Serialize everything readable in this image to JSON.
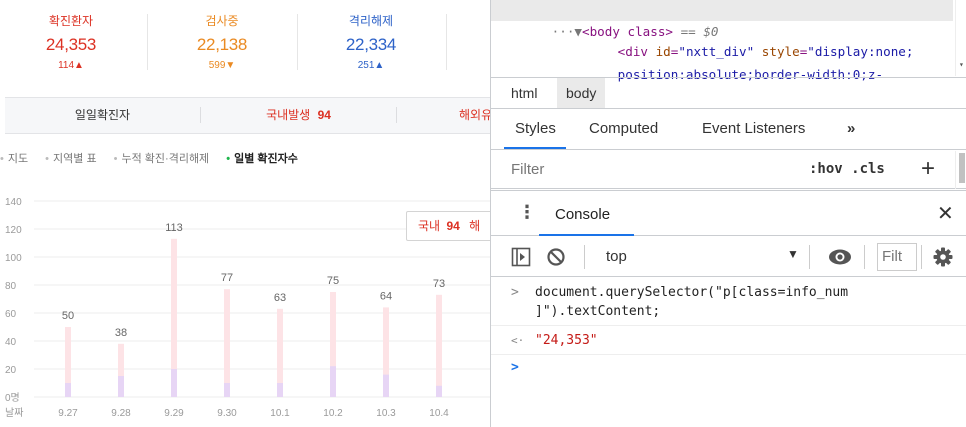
{
  "page": {
    "stats": [
      {
        "label": "확진환자",
        "value": "24,353",
        "change": "114▲",
        "color": "#dc3123"
      },
      {
        "label": "검사중",
        "value": "22,138",
        "change": "599▼",
        "color": "#ea8a22"
      },
      {
        "label": "격리해제",
        "value": "22,334",
        "change": "251▲",
        "color": "#2d62c8"
      }
    ],
    "tabs": [
      {
        "label": "일일확진자",
        "count": ""
      },
      {
        "label": "국내발생",
        "count": "94"
      },
      {
        "label": "해외유",
        "count": ""
      }
    ],
    "subnav": [
      "지도",
      "지역별 표",
      "누적 확진·격리해제",
      "일별 확진자수"
    ],
    "tooltip": {
      "label": "국내",
      "value": "94",
      "extra": "해"
    }
  },
  "chart_data": {
    "type": "bar",
    "categories": [
      "9.27",
      "9.28",
      "9.29",
      "9.30",
      "10.1",
      "10.2",
      "10.3",
      "10.4"
    ],
    "series": [
      {
        "values": [
          50,
          38,
          113,
          77,
          63,
          75,
          64,
          73
        ],
        "color": "#fde3e6"
      },
      {
        "values": [
          10,
          15,
          20,
          10,
          10,
          22,
          16,
          8
        ],
        "color": "#e7d5f5"
      }
    ],
    "yticks": [
      "0명",
      "20",
      "40",
      "60",
      "80",
      "100",
      "120",
      "140"
    ],
    "xlabel": "날짜",
    "ylim": [
      0,
      140
    ]
  },
  "devtools": {
    "dom": {
      "ellipsis": "···",
      "arrow": "▼",
      "line1_tag": "<body class>",
      "line1_eq": " == $0",
      "line2_tag_open": "<div ",
      "line2_attr1": "id",
      "line2_val1": "\"nxtt_div\"",
      "line2_attr2": "style",
      "line2_val2": "\"display:none;",
      "line3_val": "position:absolute;border-width:0;z-"
    },
    "crumbs": [
      "html",
      "body"
    ],
    "panel_tabs": [
      "Styles",
      "Computed",
      "Event Listeners",
      "»"
    ],
    "filter": {
      "placeholder": "Filter",
      "hov": ":hov .cls",
      "plus": "+"
    },
    "drawer": {
      "kebab": "⋮",
      "title": "Console",
      "close": "✕"
    },
    "console_toolbar": {
      "context": "top",
      "filter_placeholder": "Filt"
    },
    "console": {
      "prompt": ">",
      "input_line1": "document.querySelector(\"p[class=info_num",
      "input_line2": "]\").textContent;",
      "result_prefix": "<·",
      "result": "\"24,353\"",
      "caret": ">"
    }
  }
}
